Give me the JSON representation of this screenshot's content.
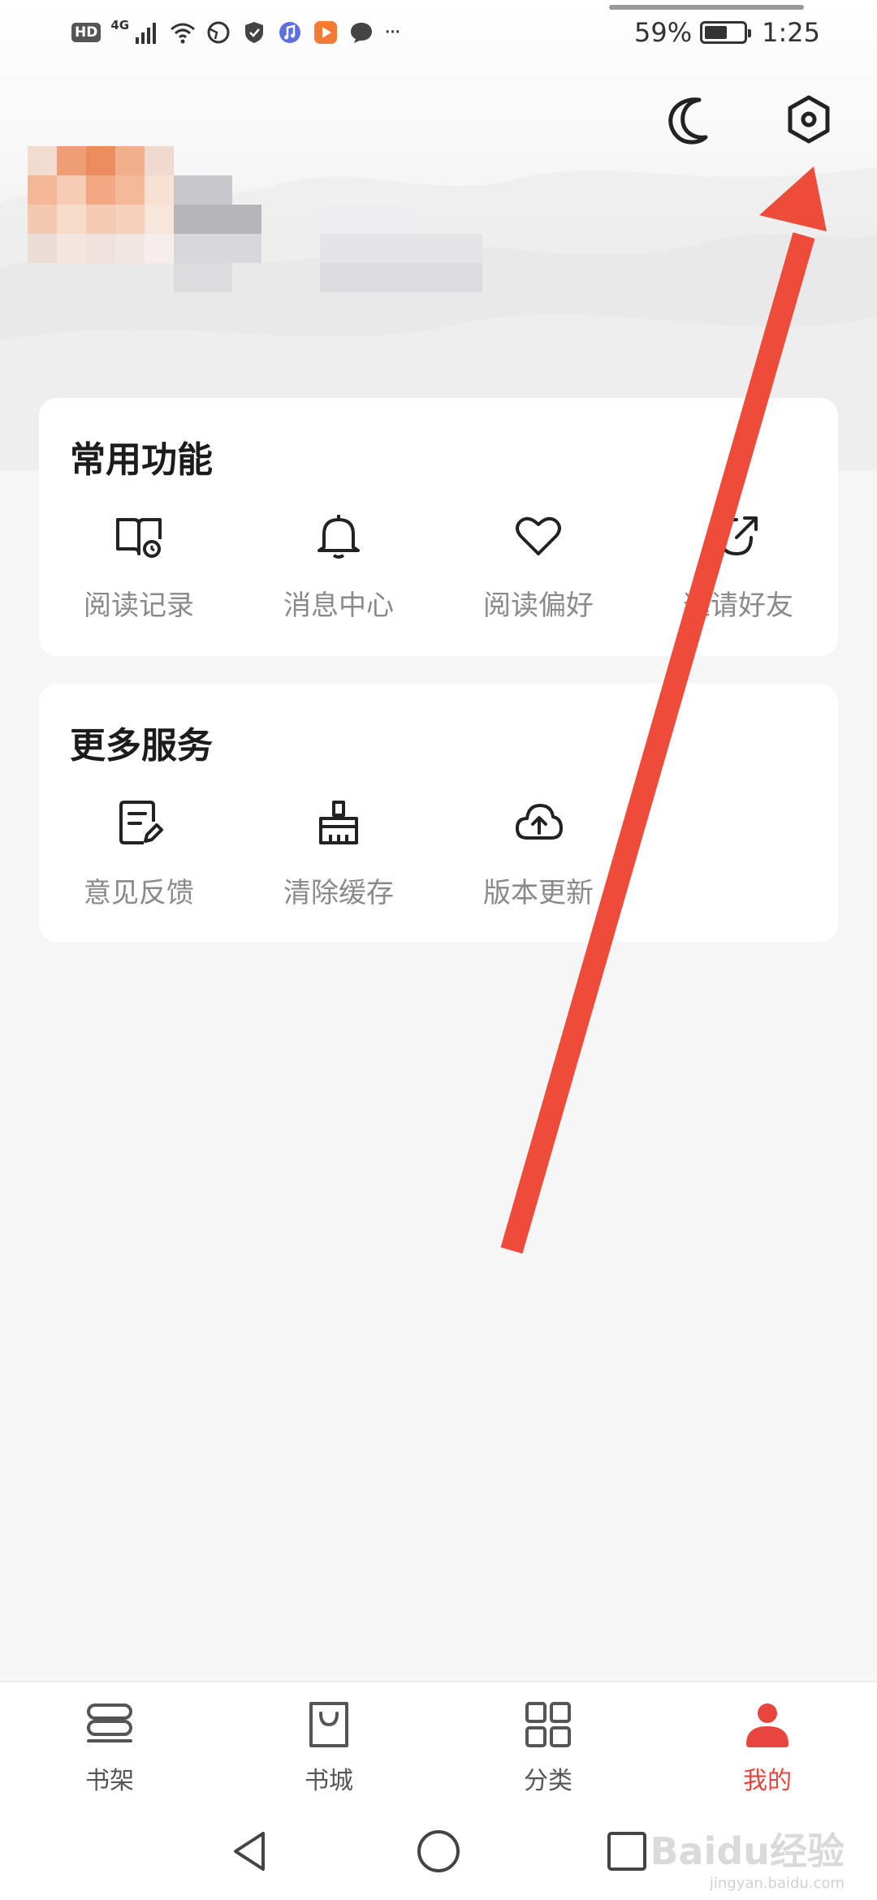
{
  "status_bar": {
    "hd": "HD",
    "network": "4G",
    "battery_text": "59%",
    "battery_level": 0.59,
    "time": "1:25",
    "more": "···"
  },
  "header": {
    "night_mode_icon": "moon-icon",
    "settings_icon": "settings-hexagon-icon"
  },
  "common_functions": {
    "title": "常用功能",
    "items": [
      {
        "label": "阅读记录",
        "icon": "book-history-icon"
      },
      {
        "label": "消息中心",
        "icon": "bell-icon"
      },
      {
        "label": "阅读偏好",
        "icon": "heart-icon"
      },
      {
        "label": "邀请好友",
        "icon": "share-icon"
      }
    ]
  },
  "more_services": {
    "title": "更多服务",
    "items": [
      {
        "label": "意见反馈",
        "icon": "feedback-edit-icon"
      },
      {
        "label": "清除缓存",
        "icon": "broom-icon"
      },
      {
        "label": "版本更新",
        "icon": "cloud-upload-icon"
      }
    ]
  },
  "bottom_nav": {
    "items": [
      {
        "label": "书架",
        "icon": "bookshelf-icon"
      },
      {
        "label": "书城",
        "icon": "bookstore-bag-icon"
      },
      {
        "label": "分类",
        "icon": "category-grid-icon"
      },
      {
        "label": "我的",
        "icon": "user-icon"
      }
    ],
    "active_index": 3
  },
  "colors": {
    "accent": "#e8453c",
    "annotation_arrow": "#ee4b3b"
  },
  "watermark": {
    "text": "Baidu经验",
    "sub": "jingyan.baidu.com"
  }
}
